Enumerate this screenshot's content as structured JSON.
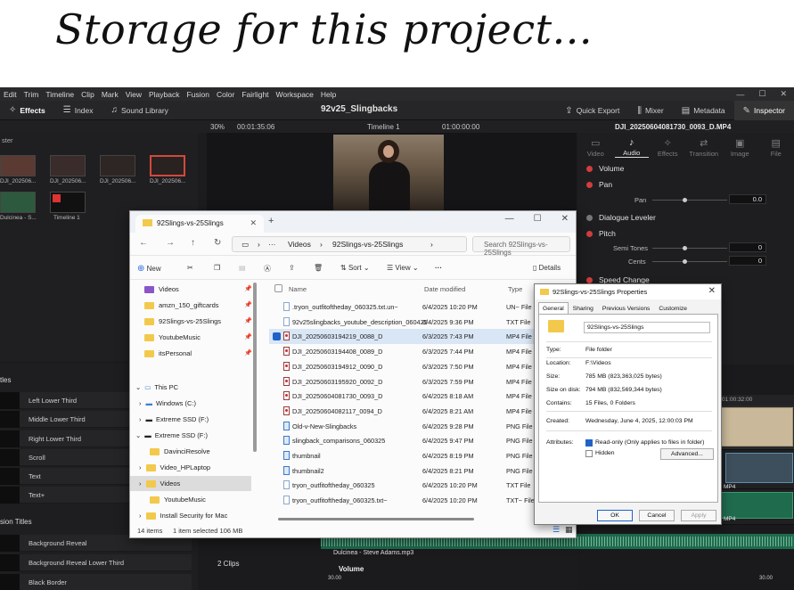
{
  "heading": "Storage for this project...",
  "resolve": {
    "menu": [
      "Edit",
      "Trim",
      "Timeline",
      "Clip",
      "Mark",
      "View",
      "Playback",
      "Fusion",
      "Color",
      "Fairlight",
      "Workspace",
      "Help"
    ],
    "toolbar_left": [
      {
        "label": "Effects",
        "icon": "effects-icon"
      },
      {
        "label": "Index",
        "icon": "index-icon"
      },
      {
        "label": "Sound Library",
        "icon": "sound-library-icon"
      }
    ],
    "project_name": "92v25_Slingbacks",
    "toolbar_right": [
      "Quick Export",
      "Mixer",
      "Metadata",
      "Inspector"
    ],
    "zoom": "30%",
    "timecode_left": "00:01:35:06",
    "timeline_name": "Timeline 1",
    "timecode_right": "01:00:00:00",
    "clip_name": "DJI_20250604081730_0093_D.MP4",
    "pool_title": "ster",
    "pool_clips": [
      "DJI_202506...",
      "DJI_202506...",
      "DJI_202506...",
      "DJI_202506..."
    ],
    "pool_clips_row2": [
      "Dulcinea - S...",
      "Timeline 1"
    ],
    "inspector_tabs": [
      "Video",
      "Audio",
      "Effects",
      "Transition",
      "Image",
      "File"
    ],
    "inspector": {
      "volume": "Volume",
      "pan": "Pan",
      "pan_sub": "Pan",
      "pan_value": "0.0",
      "dialogue": "Dialogue Leveler",
      "pitch": "Pitch",
      "semi_tones": "Semi Tones",
      "semi_value": "0",
      "cents": "Cents",
      "cents_value": "0",
      "speed": "Speed Change"
    },
    "titles_section": "tles",
    "titles": [
      "Left Lower Third",
      "Middle Lower Third",
      "Right Lower Third",
      "Scroll",
      "Text",
      "Text+"
    ],
    "fusion_section": "sion Titles",
    "fusion_titles": [
      "Background Reveal",
      "Background Reveal Lower Third",
      "Black Border"
    ],
    "clips_count": "2 Clips",
    "volume_label": "Volume",
    "scale_left": "30.00",
    "scale_right": "30.00",
    "audio_clip": "Dulcinea - Steve Adams.mp3",
    "ruler_time": "01:00:32:00",
    "clip_mp4_a": "MP4",
    "clip_mp4_b": "MP4"
  },
  "explorer": {
    "tab_title": "92Slings-vs-25Slings",
    "path": [
      "Videos",
      "92Slings-vs-25Slings"
    ],
    "search_placeholder": "Search 92Slings-vs-25Slings",
    "commands": {
      "new": "New",
      "sort": "Sort",
      "view": "View",
      "details": "Details"
    },
    "nav": [
      {
        "label": "Videos",
        "pinned": true
      },
      {
        "label": "amzn_150_giftcards",
        "pinned": true
      },
      {
        "label": "92Slings-vs-25Slings",
        "pinned": true
      },
      {
        "label": "YoutubeMusic",
        "pinned": true
      },
      {
        "label": "itsPersonal",
        "pinned": true
      }
    ],
    "tree": {
      "this_pc": "This PC",
      "windows": "Windows (C:)",
      "ext_ssd_1": "Extreme SSD (F:)",
      "ext_ssd_2": "Extreme SSD (F:)",
      "davinci": "DavinciResolve",
      "video_hp": "Video_HPLaptop",
      "videos": "Videos",
      "youtube": "YoutubeMusic",
      "install": "Install Security for Mac"
    },
    "columns": {
      "name": "Name",
      "date": "Date modified",
      "type": "Type"
    },
    "files": [
      {
        "name": ".tryon_outfitoftheday_060325.txt.un~",
        "date": "6/4/2025 10:20 PM",
        "type": "UN~ File",
        "kind": "doc",
        "selected": false
      },
      {
        "name": "92v25slingbacks_youtube_description_060425",
        "date": "6/4/2025 9:36 PM",
        "type": "TXT File",
        "kind": "doc",
        "selected": false
      },
      {
        "name": "DJI_20250603194219_0088_D",
        "date": "6/3/2025 7:43 PM",
        "type": "MP4 File",
        "kind": "mp4",
        "selected": true
      },
      {
        "name": "DJI_20250603194408_0089_D",
        "date": "6/3/2025 7:44 PM",
        "type": "MP4 File",
        "kind": "mp4",
        "selected": false
      },
      {
        "name": "DJI_20250603194912_0090_D",
        "date": "6/3/2025 7:50 PM",
        "type": "MP4 File",
        "kind": "mp4",
        "selected": false
      },
      {
        "name": "DJI_20250603195920_0092_D",
        "date": "6/3/2025 7:59 PM",
        "type": "MP4 File",
        "kind": "mp4",
        "selected": false
      },
      {
        "name": "DJI_20250604081730_0093_D",
        "date": "6/4/2025 8:18 AM",
        "type": "MP4 File",
        "kind": "mp4",
        "selected": false
      },
      {
        "name": "DJI_20250604082117_0094_D",
        "date": "6/4/2025 8:21 AM",
        "type": "MP4 File",
        "kind": "mp4",
        "selected": false
      },
      {
        "name": "Old-v-New-Slingbacks",
        "date": "6/4/2025 9:28 PM",
        "type": "PNG File",
        "kind": "png",
        "selected": false
      },
      {
        "name": "slingback_comparisons_060325",
        "date": "6/4/2025 9:47 PM",
        "type": "PNG File",
        "kind": "png",
        "selected": false
      },
      {
        "name": "thumbnail",
        "date": "6/4/2025 8:19 PM",
        "type": "PNG File",
        "kind": "png",
        "selected": false
      },
      {
        "name": "thumbnail2",
        "date": "6/4/2025 8:21 PM",
        "type": "PNG File",
        "kind": "png",
        "selected": false
      },
      {
        "name": "tryon_outfitoftheday_060325",
        "date": "6/4/2025 10:20 PM",
        "type": "TXT File",
        "kind": "doc",
        "selected": false
      },
      {
        "name": "tryon_outfitoftheday_060325.txt~",
        "date": "6/4/2025 10:20 PM",
        "type": "TXT~ File",
        "kind": "doc",
        "selected": false
      }
    ],
    "status_items": "14 items",
    "status_selected": "1 item selected  106 MB"
  },
  "properties": {
    "title": "92Slings-vs-25Slings Properties",
    "tabs": [
      "General",
      "Sharing",
      "Previous Versions",
      "Customize"
    ],
    "name_value": "92Slings-vs-25Slings",
    "rows": [
      {
        "label": "Type:",
        "value": "File folder"
      },
      {
        "label": "Location:",
        "value": "F:\\Videos"
      },
      {
        "label": "Size:",
        "value": "785 MB (823,363,025 bytes)"
      },
      {
        "label": "Size on disk:",
        "value": "794 MB (832,569,344 bytes)"
      },
      {
        "label": "Contains:",
        "value": "15 Files, 0 Folders"
      },
      {
        "label": "Created:",
        "value": "Wednesday, June 4, 2025, 12:00:03 PM"
      }
    ],
    "attributes_label": "Attributes:",
    "readonly_label": "Read-only (Only applies to files in folder)",
    "hidden_label": "Hidden",
    "advanced": "Advanced...",
    "ok": "OK",
    "cancel": "Cancel",
    "apply": "Apply"
  }
}
